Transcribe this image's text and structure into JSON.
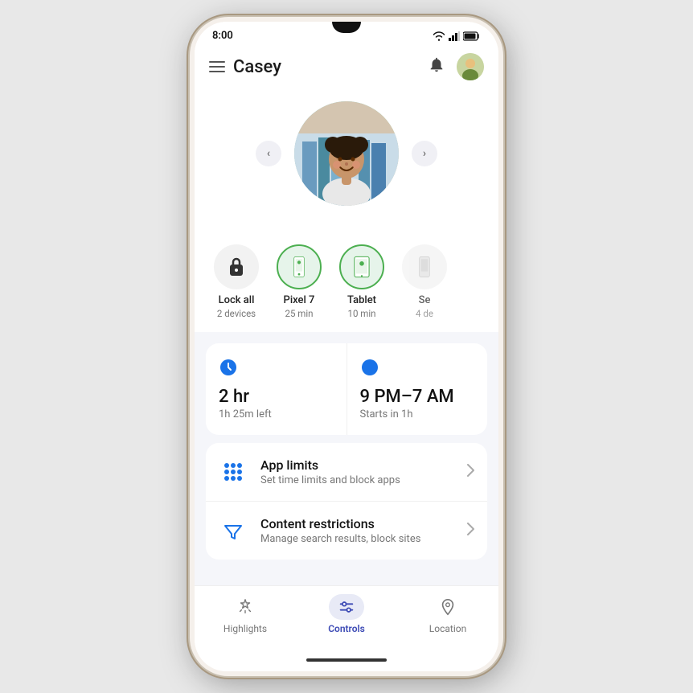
{
  "statusBar": {
    "time": "8:00"
  },
  "header": {
    "title": "Casey",
    "bellLabel": "🔔",
    "menuLabel": "☰"
  },
  "profile": {
    "arrowLeft": "‹",
    "arrowRight": "›"
  },
  "devices": [
    {
      "id": "lock-all",
      "icon": "🔒",
      "name": "Lock all",
      "sub": "2 devices",
      "ring": false
    },
    {
      "id": "pixel7",
      "icon": "📱",
      "name": "Pixel 7",
      "sub": "25 min",
      "ring": true
    },
    {
      "id": "tablet",
      "icon": "📱",
      "name": "Tablet",
      "sub": "10 min",
      "ring": true
    },
    {
      "id": "se",
      "icon": "📱",
      "name": "Se",
      "sub": "4 de",
      "ring": false
    }
  ],
  "timeCards": [
    {
      "id": "screen-time",
      "icon": "🕐",
      "iconColor": "#1a73e8",
      "value": "2 hr",
      "sub": "1h 25m left"
    },
    {
      "id": "bedtime",
      "icon": "🌙",
      "iconColor": "#1a73e8",
      "value": "9 PM–7 AM",
      "sub": "Starts in 1h"
    }
  ],
  "menuItems": [
    {
      "id": "app-limits",
      "title": "App limits",
      "subtitle": "Set time limits and block apps",
      "icon": "grid",
      "iconColor": "#1a73e8"
    },
    {
      "id": "content-restrictions",
      "title": "Content restrictions",
      "subtitle": "Manage search results, block sites",
      "icon": "funnel",
      "iconColor": "#1a73e8"
    }
  ],
  "bottomNav": [
    {
      "id": "highlights",
      "label": "Highlights",
      "icon": "sparkle",
      "active": false
    },
    {
      "id": "controls",
      "label": "Controls",
      "icon": "sliders",
      "active": true
    },
    {
      "id": "location",
      "label": "Location",
      "icon": "pin",
      "active": false
    }
  ]
}
